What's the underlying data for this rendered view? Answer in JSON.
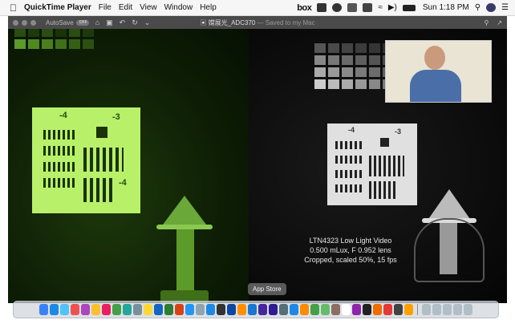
{
  "menubar": {
    "apple_icon": "apple-icon",
    "app_name": "QuickTime Player",
    "items": [
      "File",
      "Edit",
      "View",
      "Window",
      "Help"
    ],
    "box_logo": "box",
    "clock": "Sun 1:18 PM"
  },
  "titlebar": {
    "autosave_label": "AutoSave",
    "autosave_state": "OFF",
    "document_name": "嫦展光_ADC370",
    "saved_status": " — Saved to my Mac"
  },
  "caption": {
    "line1": "LTN4323 Low Light Video",
    "line2": "0.500 mLux, F 0.952 lens",
    "line3": "Cropped, scaled 50%, 15 fps"
  },
  "tooltip": {
    "text": "App Store"
  },
  "left_chart": {
    "label_a": "-4",
    "label_b": "-3",
    "label_c": "-4"
  },
  "right_chart": {
    "label_a": "-4",
    "label_b": "-3"
  },
  "colors": {
    "green_bright": "#b8f06a",
    "green_mid": "#4f8a1f",
    "gray_bright": "#e8e8e8"
  },
  "dock": {
    "icons": [
      "finder-icon",
      "safari-icon",
      "mail-icon",
      "calendar-icon",
      "photos-icon",
      "notes-icon",
      "music-icon",
      "messages-icon",
      "maps-icon",
      "settings-icon",
      "chrome-icon",
      "word-icon",
      "excel-icon",
      "powerpoint-icon",
      "zoom-icon",
      "preview-icon",
      "appstore-icon",
      "terminal-icon",
      "photoshop-icon",
      "illustrator-icon",
      "lightroom-icon",
      "premiere-icon",
      "aftereffects-icon",
      "quicktime-icon",
      "keynote-icon",
      "pages-icon",
      "numbers-icon",
      "facetime-icon",
      "contacts-icon",
      "reminders-icon",
      "podcasts-icon",
      "tv-icon",
      "books-icon",
      "news-icon",
      "stocks-icon",
      "home-icon"
    ],
    "trailing": [
      "folder-icon",
      "downloads-icon",
      "screen-icon",
      "window-icon",
      "trash-icon"
    ]
  }
}
